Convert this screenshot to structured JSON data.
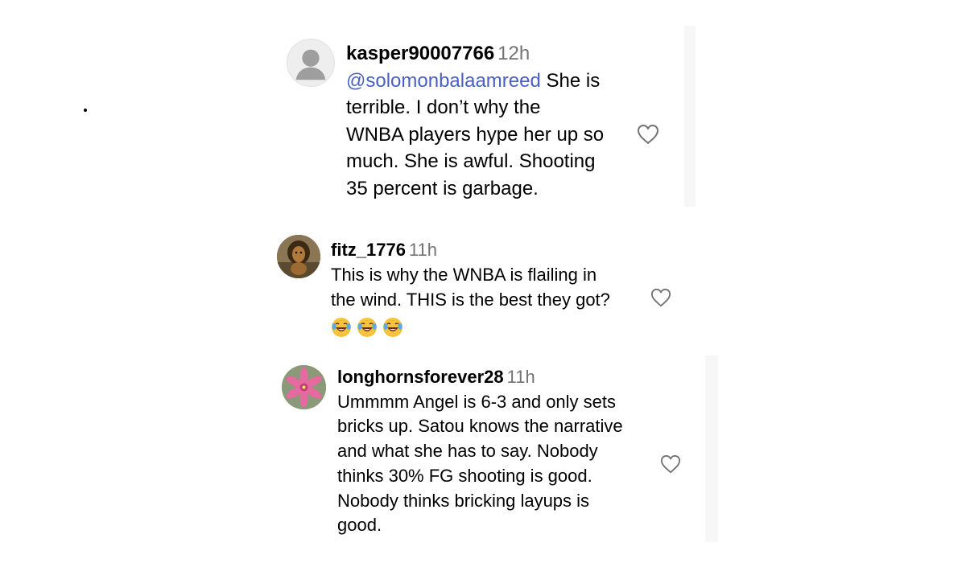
{
  "comments": [
    {
      "username": "kasper90007766",
      "time": "12h",
      "mention": "@solomonbalaamreed",
      "text_after_mention": " She is",
      "lines": [
        "terrible. I don’t why the",
        "WNBA players hype her up so",
        "much. She is awful. Shooting",
        "35 percent is garbage."
      ],
      "avatar_icon": "default-user-avatar-icon"
    },
    {
      "username": "fitz_1776",
      "time": "11h",
      "lines": [
        "This is why the WNBA is flailing in",
        "the wind. THIS is the best they got?"
      ],
      "emojis": [
        "face-with-tears-of-joy",
        "face-with-tears-of-joy",
        "face-with-tears-of-joy"
      ],
      "avatar_icon": "lion-avatar-icon"
    },
    {
      "username": "longhornsforever28",
      "time": "11h",
      "lines": [
        "Ummmm Angel is 6-3 and only sets",
        "bricks up. Satou knows the narrative",
        "and what she has to say. Nobody",
        "thinks 30% FG shooting is good.",
        "Nobody thinks bricking layups is",
        "good."
      ],
      "avatar_icon": "pink-flower-avatar-icon"
    }
  ],
  "colors": {
    "username": "#000000",
    "time": "#737373",
    "mention": "#4a5fc1",
    "heart_stroke": "#737373"
  }
}
